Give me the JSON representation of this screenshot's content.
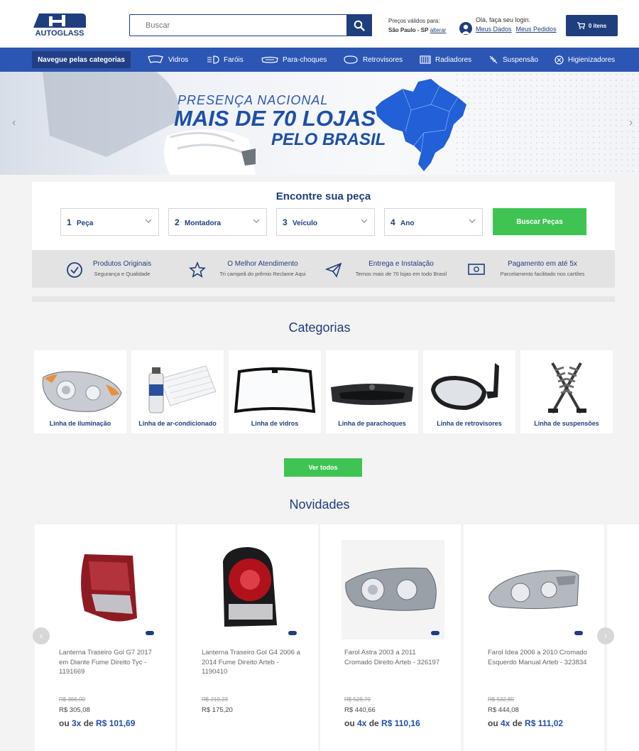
{
  "header": {
    "logo_text": "AUTOGLASS",
    "search_placeholder": "Buscar",
    "prices_label": "Preços válidos para:",
    "prices_location": "São Paulo - SP",
    "prices_change": "alterar",
    "login_greeting": "Olá, faça seu login.",
    "my_data": "Meus Dados",
    "my_orders": "Meus Pedidos",
    "cart_label": "0 itens"
  },
  "nav": {
    "categories_label": "Navegue pelas categorias",
    "items": [
      {
        "label": "Vidros",
        "icon": "windshield-icon"
      },
      {
        "label": "Faróis",
        "icon": "headlight-icon"
      },
      {
        "label": "Para-choques",
        "icon": "bumper-icon"
      },
      {
        "label": "Retrovisores",
        "icon": "mirror-icon"
      },
      {
        "label": "Radiadores",
        "icon": "radiator-icon"
      },
      {
        "label": "Suspensão",
        "icon": "suspension-icon"
      },
      {
        "label": "Higienizadores",
        "icon": "sanitizer-icon"
      }
    ]
  },
  "banner": {
    "line1": "PRESENÇA NACIONAL",
    "line2": "MAIS DE 70 LOJAS",
    "line3": "PELO BRASIL"
  },
  "finder": {
    "title": "Encontre sua peça",
    "selects": [
      {
        "num": "1",
        "label": "Peça"
      },
      {
        "num": "2",
        "label": "Montadora"
      },
      {
        "num": "3",
        "label": "Veículo"
      },
      {
        "num": "4",
        "label": "Ano"
      }
    ],
    "button": "Buscar Peças"
  },
  "features": [
    {
      "title": "Produtos Originais",
      "sub": "Segurança e Qualidade",
      "icon": "check-circle-icon"
    },
    {
      "title": "O Melhor Atendimento",
      "sub": "Tri campeã do prêmio Reclame Aqui",
      "icon": "star-icon"
    },
    {
      "title": "Entrega e Instalação",
      "sub": "Temos mais de 70 lojas em todo Brasil",
      "icon": "paper-plane-icon"
    },
    {
      "title": "Pagamento em até 5x",
      "sub": "Parcelamento facilitado nos cartões",
      "icon": "money-icon"
    }
  ],
  "categories": {
    "title": "Categorias",
    "items": [
      {
        "label": "Linha de iluminação"
      },
      {
        "label": "Linha de ar-condicionado"
      },
      {
        "label": "Linha de vidros"
      },
      {
        "label": "Linha de parachoques"
      },
      {
        "label": "Linha de retrovisores"
      },
      {
        "label": "Linha de suspensões"
      }
    ],
    "see_all": "Ver todos"
  },
  "novidades": {
    "title": "Novidades",
    "products": [
      {
        "name": "Lanterna Traseiro Gol G7 2017 em Diante Fume Direito Tyc - 1191669",
        "old": "R$ 366,00",
        "price": "R$ 305,08",
        "prefix": "ou ",
        "times": "3x",
        "de": " de ",
        "inst": "R$ 101,69"
      },
      {
        "name": "Lanterna Traseiro Gol G4 2006 a 2014 Fume Direito Arteb - 1190410",
        "old": "R$ 210,23",
        "price": "R$ 175,20",
        "prefix": "",
        "times": "",
        "de": "",
        "inst": ""
      },
      {
        "name": "Farol Astra 2003 a 2011 Cromado Direito Arteb - 326197",
        "old": "R$ 528,70",
        "price": "R$ 440,66",
        "prefix": "ou ",
        "times": "4x",
        "de": " de ",
        "inst": "R$ 110,16"
      },
      {
        "name": "Farol Idea 2006 a 2010 Cromado Esquerdo Manual Arteb - 323834",
        "old": "R$ 532,80",
        "price": "R$ 444,08",
        "prefix": "ou ",
        "times": "4x",
        "de": " de ",
        "inst": "R$ 111,02"
      }
    ]
  },
  "colors": {
    "primary": "#1f3e7e",
    "nav": "#2c56b3",
    "green": "#3fc453"
  }
}
